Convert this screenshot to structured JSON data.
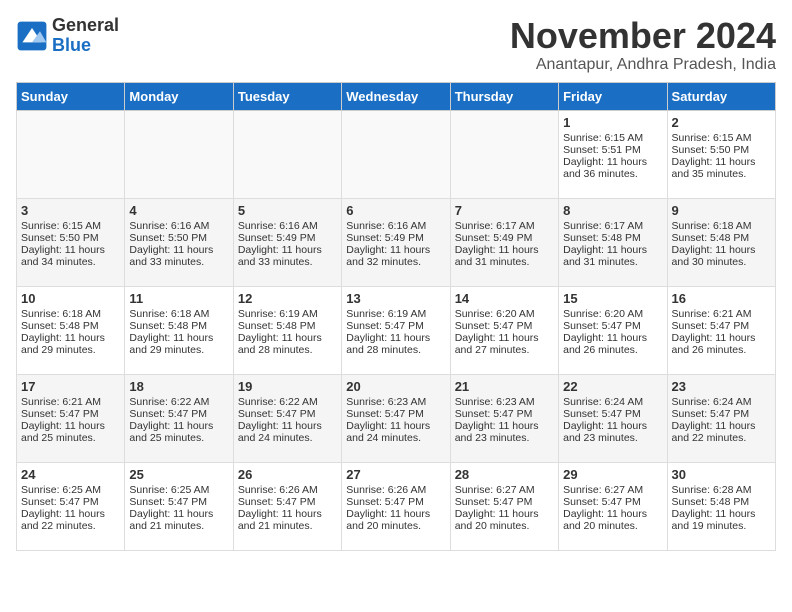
{
  "header": {
    "logo_line1": "General",
    "logo_line2": "Blue",
    "month_title": "November 2024",
    "location": "Anantapur, Andhra Pradesh, India"
  },
  "weekdays": [
    "Sunday",
    "Monday",
    "Tuesday",
    "Wednesday",
    "Thursday",
    "Friday",
    "Saturday"
  ],
  "weeks": [
    [
      {
        "day": "",
        "sunrise": "",
        "sunset": "",
        "daylight": "",
        "empty": true
      },
      {
        "day": "",
        "sunrise": "",
        "sunset": "",
        "daylight": "",
        "empty": true
      },
      {
        "day": "",
        "sunrise": "",
        "sunset": "",
        "daylight": "",
        "empty": true
      },
      {
        "day": "",
        "sunrise": "",
        "sunset": "",
        "daylight": "",
        "empty": true
      },
      {
        "day": "",
        "sunrise": "",
        "sunset": "",
        "daylight": "",
        "empty": true
      },
      {
        "day": "1",
        "sunrise": "Sunrise: 6:15 AM",
        "sunset": "Sunset: 5:51 PM",
        "daylight": "Daylight: 11 hours and 36 minutes.",
        "empty": false
      },
      {
        "day": "2",
        "sunrise": "Sunrise: 6:15 AM",
        "sunset": "Sunset: 5:50 PM",
        "daylight": "Daylight: 11 hours and 35 minutes.",
        "empty": false
      }
    ],
    [
      {
        "day": "3",
        "sunrise": "Sunrise: 6:15 AM",
        "sunset": "Sunset: 5:50 PM",
        "daylight": "Daylight: 11 hours and 34 minutes.",
        "empty": false
      },
      {
        "day": "4",
        "sunrise": "Sunrise: 6:16 AM",
        "sunset": "Sunset: 5:50 PM",
        "daylight": "Daylight: 11 hours and 33 minutes.",
        "empty": false
      },
      {
        "day": "5",
        "sunrise": "Sunrise: 6:16 AM",
        "sunset": "Sunset: 5:49 PM",
        "daylight": "Daylight: 11 hours and 33 minutes.",
        "empty": false
      },
      {
        "day": "6",
        "sunrise": "Sunrise: 6:16 AM",
        "sunset": "Sunset: 5:49 PM",
        "daylight": "Daylight: 11 hours and 32 minutes.",
        "empty": false
      },
      {
        "day": "7",
        "sunrise": "Sunrise: 6:17 AM",
        "sunset": "Sunset: 5:49 PM",
        "daylight": "Daylight: 11 hours and 31 minutes.",
        "empty": false
      },
      {
        "day": "8",
        "sunrise": "Sunrise: 6:17 AM",
        "sunset": "Sunset: 5:48 PM",
        "daylight": "Daylight: 11 hours and 31 minutes.",
        "empty": false
      },
      {
        "day": "9",
        "sunrise": "Sunrise: 6:18 AM",
        "sunset": "Sunset: 5:48 PM",
        "daylight": "Daylight: 11 hours and 30 minutes.",
        "empty": false
      }
    ],
    [
      {
        "day": "10",
        "sunrise": "Sunrise: 6:18 AM",
        "sunset": "Sunset: 5:48 PM",
        "daylight": "Daylight: 11 hours and 29 minutes.",
        "empty": false
      },
      {
        "day": "11",
        "sunrise": "Sunrise: 6:18 AM",
        "sunset": "Sunset: 5:48 PM",
        "daylight": "Daylight: 11 hours and 29 minutes.",
        "empty": false
      },
      {
        "day": "12",
        "sunrise": "Sunrise: 6:19 AM",
        "sunset": "Sunset: 5:48 PM",
        "daylight": "Daylight: 11 hours and 28 minutes.",
        "empty": false
      },
      {
        "day": "13",
        "sunrise": "Sunrise: 6:19 AM",
        "sunset": "Sunset: 5:47 PM",
        "daylight": "Daylight: 11 hours and 28 minutes.",
        "empty": false
      },
      {
        "day": "14",
        "sunrise": "Sunrise: 6:20 AM",
        "sunset": "Sunset: 5:47 PM",
        "daylight": "Daylight: 11 hours and 27 minutes.",
        "empty": false
      },
      {
        "day": "15",
        "sunrise": "Sunrise: 6:20 AM",
        "sunset": "Sunset: 5:47 PM",
        "daylight": "Daylight: 11 hours and 26 minutes.",
        "empty": false
      },
      {
        "day": "16",
        "sunrise": "Sunrise: 6:21 AM",
        "sunset": "Sunset: 5:47 PM",
        "daylight": "Daylight: 11 hours and 26 minutes.",
        "empty": false
      }
    ],
    [
      {
        "day": "17",
        "sunrise": "Sunrise: 6:21 AM",
        "sunset": "Sunset: 5:47 PM",
        "daylight": "Daylight: 11 hours and 25 minutes.",
        "empty": false
      },
      {
        "day": "18",
        "sunrise": "Sunrise: 6:22 AM",
        "sunset": "Sunset: 5:47 PM",
        "daylight": "Daylight: 11 hours and 25 minutes.",
        "empty": false
      },
      {
        "day": "19",
        "sunrise": "Sunrise: 6:22 AM",
        "sunset": "Sunset: 5:47 PM",
        "daylight": "Daylight: 11 hours and 24 minutes.",
        "empty": false
      },
      {
        "day": "20",
        "sunrise": "Sunrise: 6:23 AM",
        "sunset": "Sunset: 5:47 PM",
        "daylight": "Daylight: 11 hours and 24 minutes.",
        "empty": false
      },
      {
        "day": "21",
        "sunrise": "Sunrise: 6:23 AM",
        "sunset": "Sunset: 5:47 PM",
        "daylight": "Daylight: 11 hours and 23 minutes.",
        "empty": false
      },
      {
        "day": "22",
        "sunrise": "Sunrise: 6:24 AM",
        "sunset": "Sunset: 5:47 PM",
        "daylight": "Daylight: 11 hours and 23 minutes.",
        "empty": false
      },
      {
        "day": "23",
        "sunrise": "Sunrise: 6:24 AM",
        "sunset": "Sunset: 5:47 PM",
        "daylight": "Daylight: 11 hours and 22 minutes.",
        "empty": false
      }
    ],
    [
      {
        "day": "24",
        "sunrise": "Sunrise: 6:25 AM",
        "sunset": "Sunset: 5:47 PM",
        "daylight": "Daylight: 11 hours and 22 minutes.",
        "empty": false
      },
      {
        "day": "25",
        "sunrise": "Sunrise: 6:25 AM",
        "sunset": "Sunset: 5:47 PM",
        "daylight": "Daylight: 11 hours and 21 minutes.",
        "empty": false
      },
      {
        "day": "26",
        "sunrise": "Sunrise: 6:26 AM",
        "sunset": "Sunset: 5:47 PM",
        "daylight": "Daylight: 11 hours and 21 minutes.",
        "empty": false
      },
      {
        "day": "27",
        "sunrise": "Sunrise: 6:26 AM",
        "sunset": "Sunset: 5:47 PM",
        "daylight": "Daylight: 11 hours and 20 minutes.",
        "empty": false
      },
      {
        "day": "28",
        "sunrise": "Sunrise: 6:27 AM",
        "sunset": "Sunset: 5:47 PM",
        "daylight": "Daylight: 11 hours and 20 minutes.",
        "empty": false
      },
      {
        "day": "29",
        "sunrise": "Sunrise: 6:27 AM",
        "sunset": "Sunset: 5:47 PM",
        "daylight": "Daylight: 11 hours and 20 minutes.",
        "empty": false
      },
      {
        "day": "30",
        "sunrise": "Sunrise: 6:28 AM",
        "sunset": "Sunset: 5:48 PM",
        "daylight": "Daylight: 11 hours and 19 minutes.",
        "empty": false
      }
    ]
  ]
}
